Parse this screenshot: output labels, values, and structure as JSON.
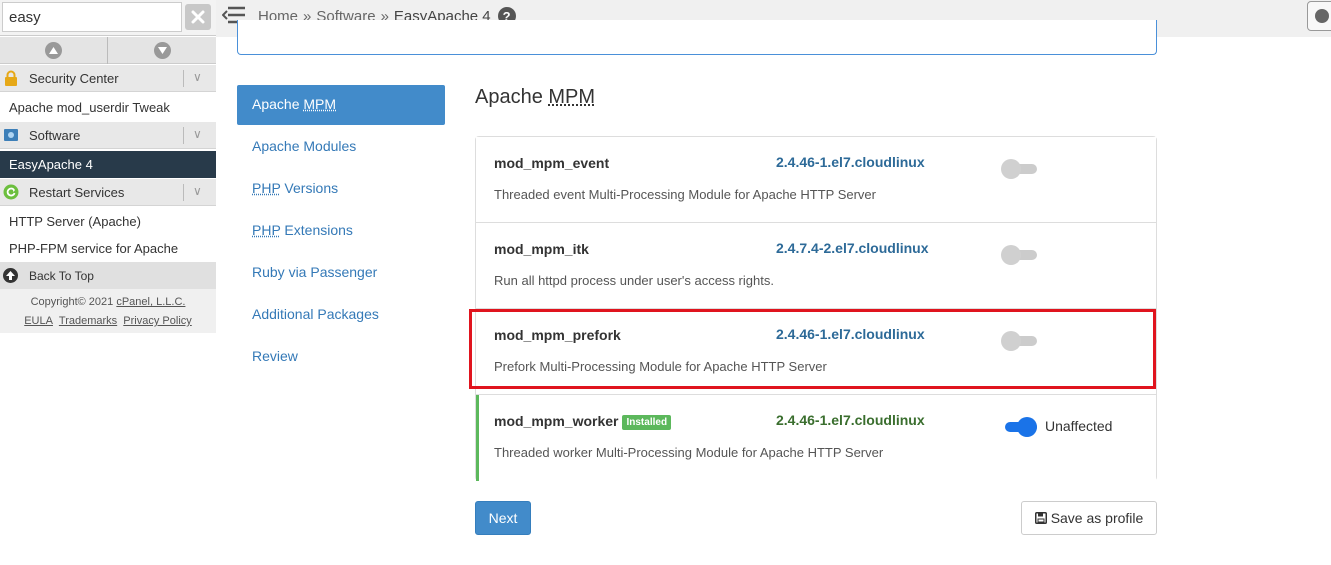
{
  "search": {
    "value": "easy"
  },
  "sidebar": {
    "groups": [
      {
        "label": "Security Center",
        "items": [
          "Apache mod_userdir Tweak"
        ]
      },
      {
        "label": "Software",
        "items": [
          "EasyApache 4"
        ]
      },
      {
        "label": "Restart Services",
        "items": [
          "HTTP Server (Apache)",
          "PHP-FPM service for Apache"
        ]
      }
    ],
    "back_to_top": "Back To Top",
    "copyright": "Copyright© 2021",
    "company": "cPanel, L.L.C.",
    "links": [
      "EULA",
      "Trademarks",
      "Privacy Policy"
    ]
  },
  "breadcrumb": {
    "home": "Home",
    "sep": "»",
    "software": "Software",
    "current": "EasyApache 4"
  },
  "steps": [
    {
      "abbr": "",
      "label_pre": "Apache ",
      "label_abbr": "MPM",
      "label_post": ""
    },
    {
      "label": "Apache Modules"
    },
    {
      "label_abbr": "PHP",
      "label_post": " Versions"
    },
    {
      "label_abbr": "PHP",
      "label_post": " Extensions"
    },
    {
      "label": "Ruby via Passenger"
    },
    {
      "label": "Additional Packages"
    },
    {
      "label": "Review"
    }
  ],
  "section": {
    "title_pre": "Apache ",
    "title_abbr": "MPM"
  },
  "modules": [
    {
      "name": "mod_mpm_event",
      "version": "2.4.46-1.el7.cloudlinux",
      "description": "Threaded event Multi-Processing Module for Apache HTTP Server",
      "enabled": false
    },
    {
      "name": "mod_mpm_itk",
      "version": "2.4.7.4-2.el7.cloudlinux",
      "description": "Run all httpd process under user's access rights.",
      "enabled": false
    },
    {
      "name": "mod_mpm_prefork",
      "version": "2.4.46-1.el7.cloudlinux",
      "description": "Prefork Multi-Processing Module for Apache HTTP Server",
      "enabled": false
    },
    {
      "name": "mod_mpm_worker",
      "badge": "Installed",
      "version": "2.4.46-1.el7.cloudlinux",
      "description": "Threaded worker Multi-Processing Module for Apache HTTP Server",
      "enabled": true,
      "status": "Unaffected"
    }
  ],
  "actions": {
    "next": "Next",
    "save_profile": "Save as profile"
  },
  "colors": {
    "primary": "#428bca",
    "installed": "#5cb85c",
    "highlight": "#e0141e",
    "toggle_on": "#1a73e8"
  }
}
